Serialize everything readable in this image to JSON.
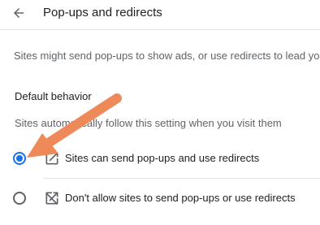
{
  "header": {
    "title": "Pop-ups and redirects",
    "back_icon": "arrow-back-icon"
  },
  "description": "Sites might send pop-ups to show ads, or use redirects to lead you",
  "default_behavior": {
    "heading": "Default behavior",
    "subtext": "Sites automatically follow this setting when you visit them",
    "options": [
      {
        "label": "Sites can send pop-ups and use redirects",
        "icon": "open-in-new-icon",
        "selected": true
      },
      {
        "label": "Don't allow sites to send pop-ups or use redirects",
        "icon": "open-in-new-off-icon",
        "selected": false
      }
    ]
  },
  "colors": {
    "accent": "#1a73e8",
    "annotation_arrow": "#ee8a5a"
  }
}
